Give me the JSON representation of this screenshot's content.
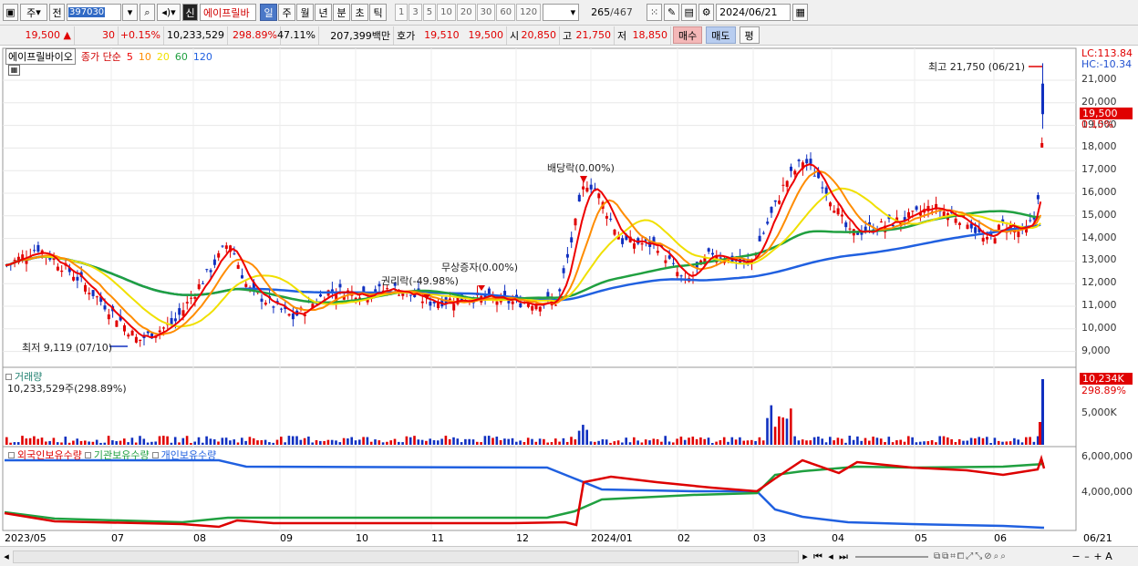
{
  "toolbar": {
    "period": "주",
    "scope": "전",
    "code": "397030",
    "stock_badge": "신",
    "stock_name": "에이프릴바",
    "tabs": [
      {
        "label": "일",
        "active": true
      },
      {
        "label": "주",
        "active": false
      },
      {
        "label": "월",
        "active": false
      },
      {
        "label": "년",
        "active": false
      },
      {
        "label": "분",
        "active": false
      },
      {
        "label": "초",
        "active": false
      },
      {
        "label": "틱",
        "active": false
      }
    ],
    "periods": [
      "1",
      "3",
      "5",
      "10",
      "20",
      "30",
      "60",
      "120"
    ],
    "count": "265",
    "total": "/467",
    "date": "2024/06/21"
  },
  "quote": {
    "price": "19,500",
    "change": "30",
    "change_pct": "+0.15%",
    "volume": "10,233,529",
    "volume_ratio": "298.89%",
    "turnover": "47.11%",
    "amount": "207,399백만",
    "bid_label": "호가",
    "bid": "19,510",
    "ask": "19,500",
    "open_label": "시",
    "open": "20,850",
    "high_label": "고",
    "high": "21,750",
    "low_label": "저",
    "low": "18,850",
    "buy_label": "매수",
    "sell_label": "매도",
    "eval_label": "평"
  },
  "price_panel": {
    "name": "에이프릴바이오",
    "ma_label": "종가 단순",
    "ma_periods": [
      {
        "label": "5",
        "color": "#ee0000"
      },
      {
        "label": "10",
        "color": "#ff8c00"
      },
      {
        "label": "20",
        "color": "#f0e000"
      },
      {
        "label": "60",
        "color": "#20a040"
      },
      {
        "label": "120",
        "color": "#2060e0"
      }
    ],
    "lc": "LC:113.84",
    "hc": "HC:-10.34",
    "y_ticks": [
      "21,000",
      "20,000",
      "19,000",
      "18,000",
      "17,000",
      "16,000",
      "15,000",
      "14,000",
      "13,000",
      "12,000",
      "11,000",
      "10,000",
      "9,000"
    ],
    "current_price_tag": "19,500",
    "current_pct": "0.15%",
    "max_label": "최고 21,750 (06/21)",
    "min_label": "최저 9,119 (07/10)",
    "events": [
      "배당락(0.00%)",
      "무상증자(0.00%)",
      "권리락(-49.98%)"
    ]
  },
  "volume_panel": {
    "title": "거래량",
    "value": "10,233,529주(298.89%)",
    "tag": "10,234K",
    "tag_pct": "298.89%",
    "tick": "5,000K"
  },
  "holding_panel": {
    "series": [
      {
        "label": "외국인보유수량",
        "color": "#dd0000"
      },
      {
        "label": "기관보유수량",
        "color": "#20a040"
      },
      {
        "label": "개인보유수량",
        "color": "#2060e0"
      }
    ],
    "ticks": [
      "6,000,000",
      "4,000,000"
    ]
  },
  "x_axis": [
    "2023/05",
    "07",
    "08",
    "09",
    "10",
    "11",
    "12",
    "2024/01",
    "02",
    "03",
    "04",
    "05",
    "06",
    "06/21"
  ]
}
